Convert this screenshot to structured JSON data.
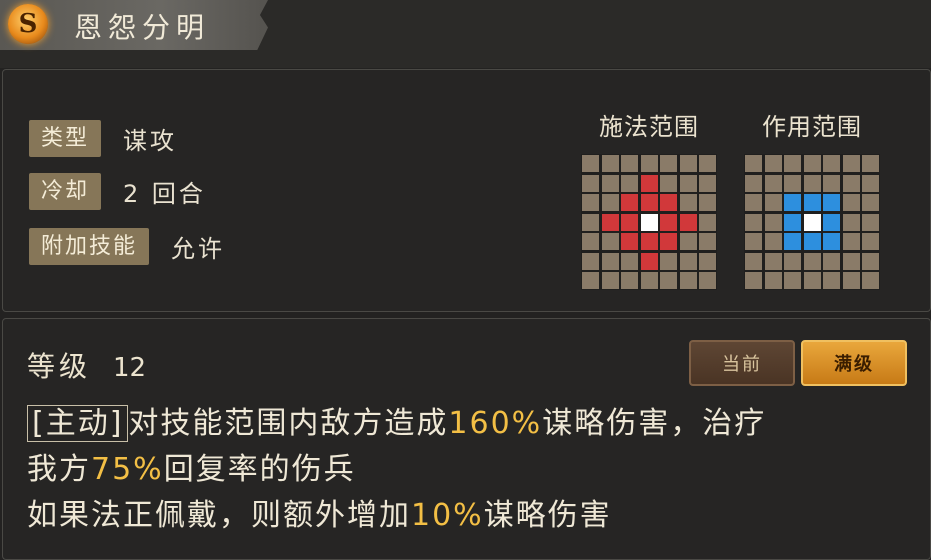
{
  "header": {
    "icon_letter": "S",
    "skill_name": "恩怨分明"
  },
  "attributes": [
    {
      "label": "类型",
      "value": "谋攻"
    },
    {
      "label": "冷却",
      "value": "2 回合"
    },
    {
      "label": "附加技能",
      "value": "允许"
    }
  ],
  "range": {
    "cast_title": "施法范围",
    "effect_title": "作用范围",
    "cast_grid": [
      "0000000",
      "000R000",
      "00RRR00",
      "0RRCRR0",
      "00RRR00",
      "000R000",
      "0000000"
    ],
    "effect_grid": [
      "0000000",
      "0000000",
      "00BBB00",
      "00BCB00",
      "00BBB00",
      "0000000",
      "0000000"
    ],
    "colors": {
      "cell": "#8a7b68",
      "cast": "#d1383a",
      "effect": "#2d8fde",
      "center": "#ffffff"
    }
  },
  "detail": {
    "level_label": "等级",
    "level_value": "12",
    "btn_current": "当前",
    "btn_max": "满级",
    "line1_tag": "[主动]",
    "line1_a": "对技能范围内敌方造成",
    "line1_pct": "160%",
    "line1_b": "谋略伤害，治疗",
    "line2_a": "我方",
    "line2_pct": "75%",
    "line2_b": "回复率的伤兵",
    "line3_a": "如果法正佩戴，则额外增加",
    "line3_pct": "10%",
    "line3_b": "谋略伤害",
    "highlight_color": "#f3bf45"
  }
}
